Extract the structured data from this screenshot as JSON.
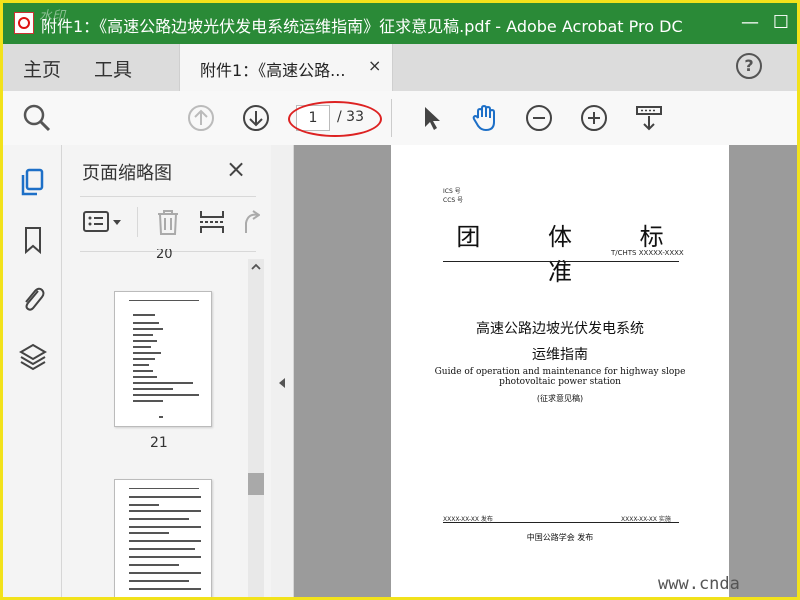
{
  "window": {
    "title": "附件1：《高速公路边坡光伏发电系统运维指南》征求意见稿.pdf - Adobe Acrobat Pro DC",
    "watermark_top": "水印",
    "minimize": "—",
    "maximize": "☐"
  },
  "menu": {
    "home": "主页",
    "tools": "工具",
    "tab_label": "附件1：《高速公路...",
    "tab_close": "×",
    "help": "?"
  },
  "toolbar": {
    "page_current": "1",
    "page_total": "/ 33"
  },
  "thumbnails": {
    "title": "页面缩略图",
    "close": "×",
    "partial_label": "20",
    "items": [
      {
        "label": "21"
      }
    ]
  },
  "document": {
    "ics": "ICS 号",
    "ccs": "CCS 号",
    "std_heading": "团 体 标 准",
    "std_number": "T/CHTS XXXXX-XXXX",
    "title_cn_1": "高速公路边坡光伏发电系统",
    "title_cn_2": "运维指南",
    "title_en_1": "Guide of operation and maintenance for highway slope",
    "title_en_2": "photovoltaic power station",
    "draft_note": "(征求意见稿)",
    "publish_date": "XXXX-XX-XX 发布",
    "implement_date": "XXXX-XX-XX 实施",
    "publisher": "中国公路学会  发布"
  },
  "watermark_bottom": "www.cnda",
  "colors": {
    "titlebar": "#2a8a37",
    "frame": "#f2e21b",
    "accent_blue": "#1d6fc7",
    "annotation_red": "#d22"
  }
}
